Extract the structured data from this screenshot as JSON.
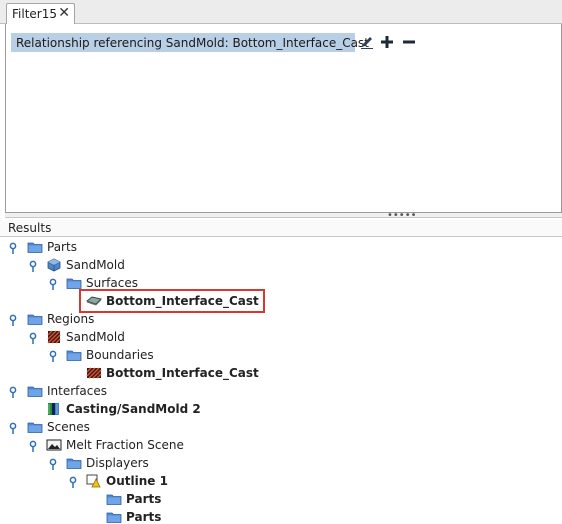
{
  "tab": {
    "label": "Filter15",
    "close_glyph": "✕"
  },
  "filter": {
    "relationship_text": "Relationship referencing SandMold: Bottom_Interface_Cast",
    "edit_icon": "pencil-icon",
    "add_icon": "plus-icon",
    "remove_icon": "minus-icon"
  },
  "splitter_grip": "•••••",
  "results": {
    "header": "Results",
    "tree": {
      "parts": "Parts",
      "sandmold_part": "SandMold",
      "surfaces": "Surfaces",
      "bottom_interface_cast_surface": "Bottom_Interface_Cast",
      "regions": "Regions",
      "sandmold_region": "SandMold",
      "boundaries": "Boundaries",
      "bottom_interface_cast_boundary": "Bottom_Interface_Cast",
      "interfaces": "Interfaces",
      "casting_sandmold_2": "Casting/SandMold 2",
      "scenes": "Scenes",
      "melt_fraction_scene": "Melt Fraction Scene",
      "displayers": "Displayers",
      "outline_1": "Outline 1",
      "parts_child_1": "Parts",
      "parts_child_2": "Parts"
    }
  },
  "colors": {
    "selection_bg": "#b8cfe5",
    "folder_blue": "#3f7fd1",
    "highlight_red": "#d9382f"
  }
}
